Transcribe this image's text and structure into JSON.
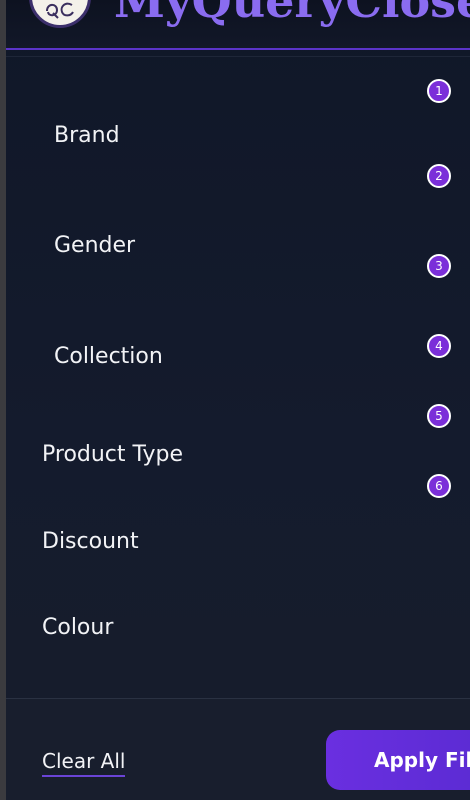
{
  "header": {
    "title": "MyQueryCloset",
    "logo_text": "QC"
  },
  "filters": [
    {
      "label": "Brand",
      "badge": "1"
    },
    {
      "label": "Gender",
      "badge": "2"
    },
    {
      "label": "Collection",
      "badge": "3"
    },
    {
      "label": "Product Type",
      "badge": "4"
    },
    {
      "label": "Discount",
      "badge": "5"
    },
    {
      "label": "Colour",
      "badge": "6"
    }
  ],
  "footer": {
    "clear_label": "Clear All",
    "apply_label": "Apply Filters"
  },
  "colors": {
    "accent": "#6a2fe0",
    "badge": "#7b2fd9",
    "panel_bg": "#121a2b",
    "title": "#8a6cf0"
  }
}
